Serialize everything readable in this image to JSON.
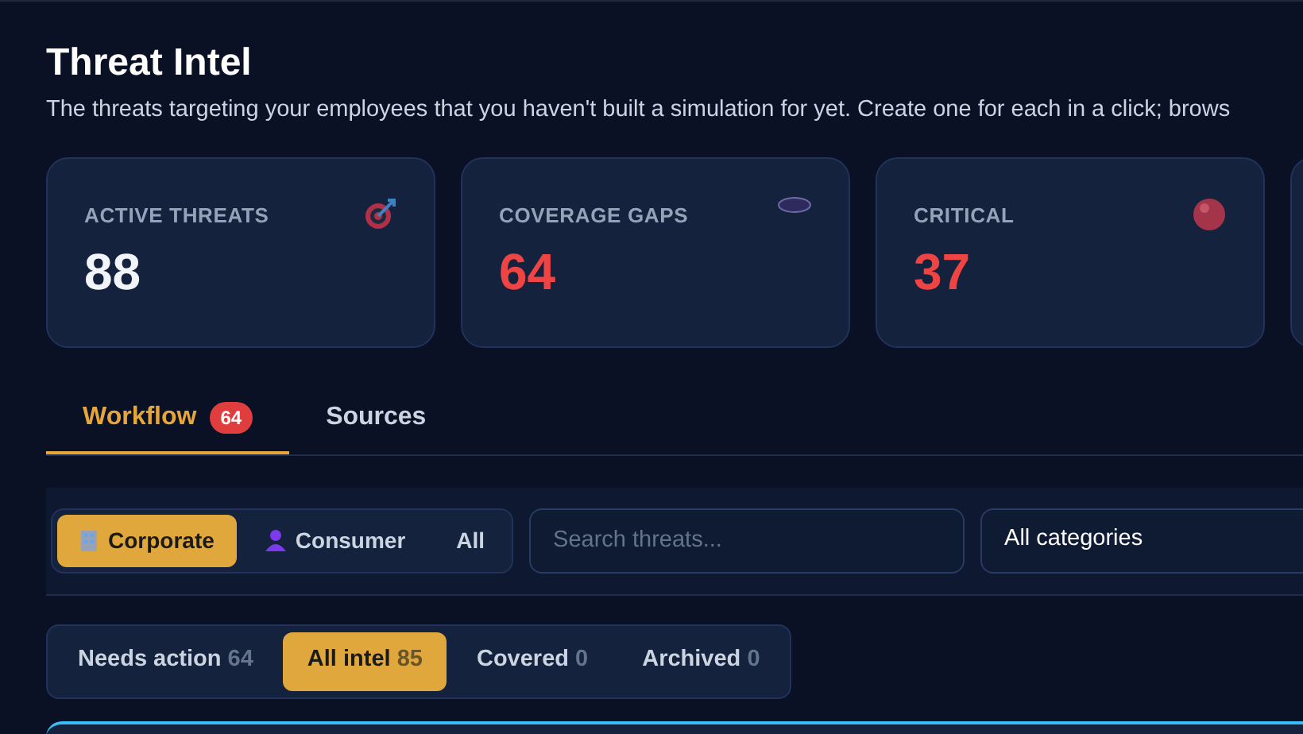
{
  "header": {
    "title": "Threat Intel",
    "subtitle": "The threats targeting your employees that you haven't built a simulation for yet. Create one for each in a click; brows"
  },
  "stats": [
    {
      "label": "ACTIVE THREATS",
      "value": "88",
      "color": "#f1f5f9",
      "kind": "target"
    },
    {
      "label": "COVERAGE GAPS",
      "value": "64",
      "color": "#ef4444",
      "kind": "disc"
    },
    {
      "label": "CRITICAL",
      "value": "37",
      "color": "#ef4444",
      "kind": "ball"
    },
    {
      "kind": "partial"
    }
  ],
  "tabs": [
    {
      "label": "Workflow",
      "badge": "64",
      "selected": true
    },
    {
      "label": "Sources",
      "selected": false
    }
  ],
  "audience": [
    {
      "label": "Corporate",
      "kind": "building",
      "selected": true
    },
    {
      "label": "Consumer",
      "kind": "person",
      "selected": false
    },
    {
      "label": "All",
      "kind": "text",
      "selected": false
    }
  ],
  "search": {
    "placeholder": "Search threats..."
  },
  "category_select": {
    "value": "All categories"
  },
  "status_filters": [
    {
      "label": "Needs action",
      "count": "64",
      "selected": false
    },
    {
      "label": "All intel",
      "count": "85",
      "selected": true
    },
    {
      "label": "Covered",
      "count": "0",
      "selected": false
    },
    {
      "label": "Archived",
      "count": "0",
      "selected": false
    }
  ]
}
